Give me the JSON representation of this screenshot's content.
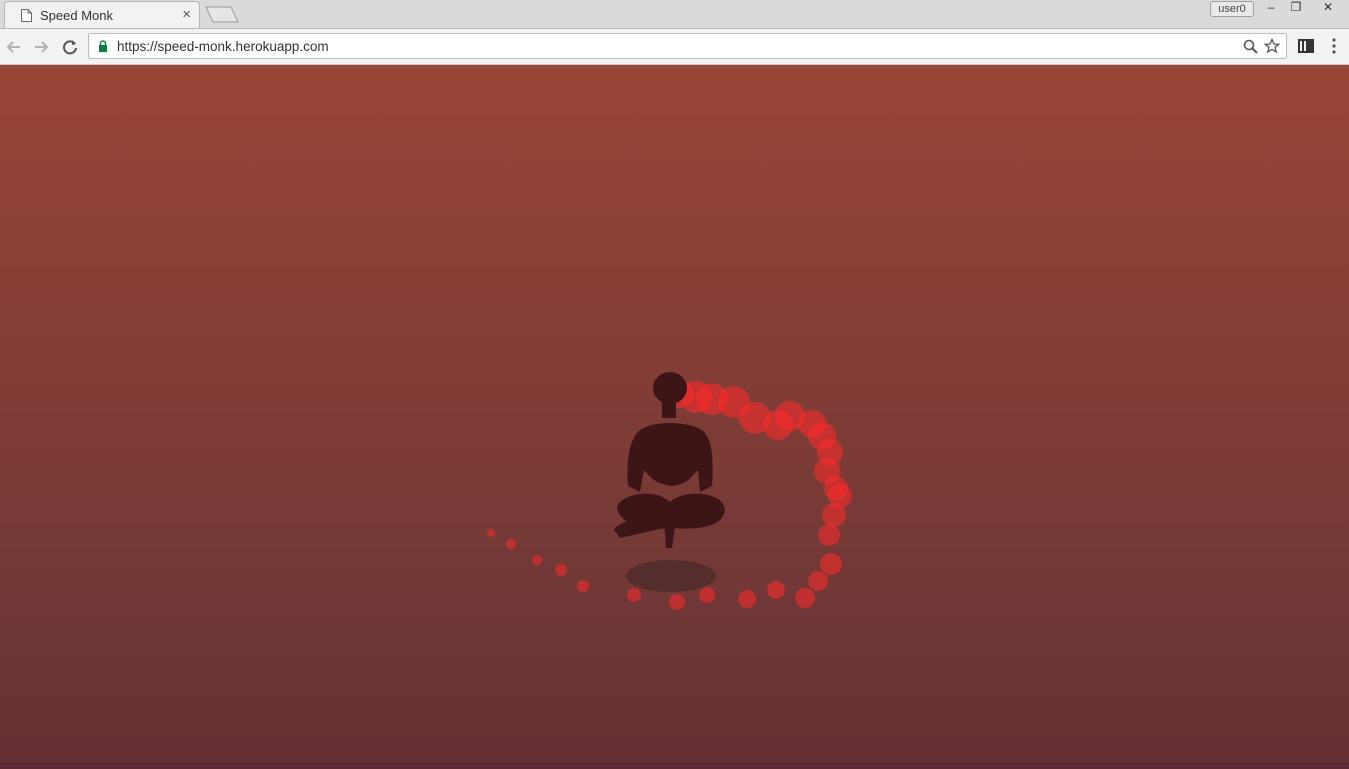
{
  "browser": {
    "tab": {
      "title": "Speed Monk",
      "close_glyph": "×"
    },
    "user_badge": "user0",
    "window_controls": {
      "minimize": "–",
      "maximize": "❐",
      "close": "✕"
    },
    "address_bar": {
      "url": "https://speed-monk.herokuapp.com",
      "secure": true
    },
    "icons": [
      "back-arrow-icon",
      "forward-arrow-icon",
      "reload-icon",
      "lock-icon",
      "zoom-icon",
      "bookmark-star-icon",
      "extension-icon",
      "menu-dots-icon"
    ]
  },
  "game": {
    "background_top": "#984535",
    "background_bottom": "#643034",
    "monk_color": "#3d1517",
    "orb_color": "#ff2a2a",
    "shadow_color": "#4d2a2c"
  }
}
